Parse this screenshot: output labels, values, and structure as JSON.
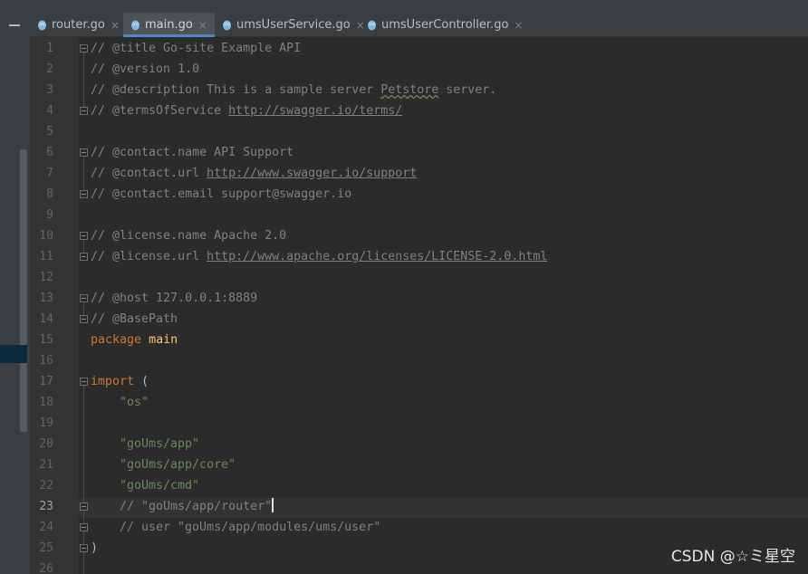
{
  "tabs": [
    {
      "label": "router.go",
      "active": false
    },
    {
      "label": "main.go",
      "active": true
    },
    {
      "label": "umsUserService.go",
      "active": false
    },
    {
      "label": "umsUserController.go",
      "active": false
    }
  ],
  "close_glyph": "×",
  "current_line": 23,
  "line_numbers": [
    "1",
    "2",
    "3",
    "4",
    "5",
    "6",
    "7",
    "8",
    "9",
    "10",
    "11",
    "12",
    "13",
    "14",
    "15",
    "16",
    "17",
    "18",
    "19",
    "20",
    "21",
    "22",
    "23",
    "24",
    "25",
    "26"
  ],
  "code": {
    "l1": "// @title Go-site Example API",
    "l2": "// @version 1.0",
    "l3_a": "// @description This is a sample server ",
    "l3_b": "Petstore",
    "l3_c": " server.",
    "l4_a": "// @termsOfService ",
    "l4_b": "http://swagger.io/terms/",
    "l6": "// @contact.name API Support",
    "l7_a": "// @contact.url ",
    "l7_b": "http://www.swagger.io/support",
    "l8": "// @contact.email support@swagger.io",
    "l10": "// @license.name Apache 2.0",
    "l11_a": "// @license.url ",
    "l11_b": "http://www.apache.org/licenses/LICENSE-2.0.html",
    "l13": "// @host 127.0.0.1:8889",
    "l14": "// @BasePath",
    "l15_kw": "package",
    "l15_name": "main",
    "l17_kw": "import",
    "l17_paren": " (",
    "l18": "\"os\"",
    "l20": "\"goUms/app\"",
    "l21": "\"goUms/app/core\"",
    "l22": "\"goUms/cmd\"",
    "l23": "// \"goUms/app/router\"",
    "l24": "// user \"goUms/app/modules/ums/user\"",
    "l25": ")"
  },
  "watermark": "CSDN @☆ミ星空"
}
